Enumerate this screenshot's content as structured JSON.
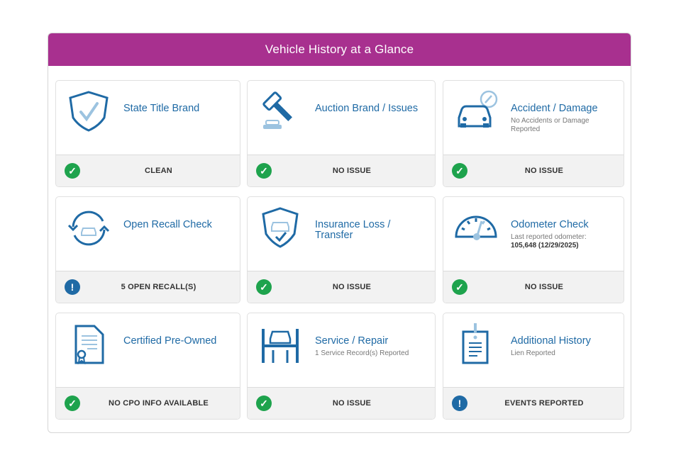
{
  "header": {
    "title": "Vehicle History at a Glance"
  },
  "cards": [
    {
      "title": "State Title Brand",
      "subtitle": "",
      "status": "CLEAN",
      "icon": "shield-check-icon",
      "status_type": "ok"
    },
    {
      "title": "Auction Brand / Issues",
      "subtitle": "",
      "status": "NO ISSUE",
      "icon": "gavel-icon",
      "status_type": "ok"
    },
    {
      "title": "Accident / Damage",
      "subtitle": "No Accidents or Damage Reported",
      "status": "NO ISSUE",
      "icon": "car-gauge-icon",
      "status_type": "ok"
    },
    {
      "title": "Open Recall Check",
      "subtitle": "",
      "status": "5 OPEN RECALL(S)",
      "icon": "recall-cycle-icon",
      "status_type": "warn"
    },
    {
      "title": "Insurance Loss / Transfer",
      "subtitle": "",
      "status": "NO ISSUE",
      "icon": "shield-car-icon",
      "status_type": "ok"
    },
    {
      "title": "Odometer Check",
      "subtitle": "Last reported odometer:",
      "subtitle_bold": "105,648 (12/29/2025)",
      "status": "NO ISSUE",
      "icon": "odometer-icon",
      "status_type": "ok"
    },
    {
      "title": "Certified Pre-Owned",
      "subtitle": "",
      "status": "NO CPO INFO AVAILABLE",
      "icon": "certificate-icon",
      "status_type": "ok"
    },
    {
      "title": "Service / Repair",
      "subtitle": "1 Service Record(s) Reported",
      "status": "NO ISSUE",
      "icon": "car-lift-icon",
      "status_type": "ok"
    },
    {
      "title": "Additional History",
      "subtitle": "Lien Reported",
      "status": "EVENTS REPORTED",
      "icon": "document-alert-icon",
      "status_type": "warn"
    }
  ],
  "colors": {
    "header_bg": "#a8308f",
    "title_blue": "#1f6aa5",
    "status_ok": "#1ea34d",
    "status_warn": "#1f6aa5"
  }
}
